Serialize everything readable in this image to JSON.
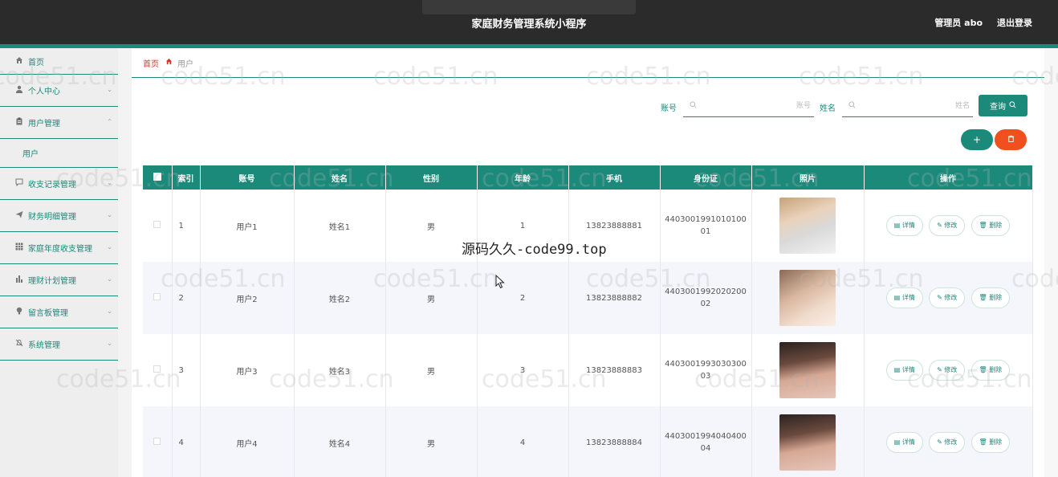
{
  "header": {
    "title": "家庭财务管理系统小程序",
    "user": "管理员 abo",
    "logout": "退出登录"
  },
  "sidebar": {
    "items": [
      {
        "label": "首页",
        "icon": "home-icon"
      },
      {
        "label": "个人中心",
        "icon": "user-icon"
      },
      {
        "label": "用户管理",
        "icon": "clipboard-icon",
        "expanded": true,
        "sub": [
          {
            "label": "用户"
          }
        ]
      },
      {
        "label": "收支记录管理",
        "icon": "chat-icon"
      },
      {
        "label": "财务明细管理",
        "icon": "send-icon"
      },
      {
        "label": "家庭年度收支管理",
        "icon": "grid-icon"
      },
      {
        "label": "理财计划管理",
        "icon": "bar-chart-icon"
      },
      {
        "label": "留言板管理",
        "icon": "bulb-icon"
      },
      {
        "label": "系统管理",
        "icon": "bell-off-icon"
      }
    ]
  },
  "breadcrumb": {
    "home": "首页",
    "current": "用户"
  },
  "search": {
    "account_label": "账号",
    "account_placeholder": "账号",
    "name_label": "姓名",
    "name_placeholder": "姓名",
    "query": "查询"
  },
  "actions": {
    "add": "+"
  },
  "table": {
    "columns": [
      "索引",
      "账号",
      "姓名",
      "性别",
      "年龄",
      "手机",
      "身份证",
      "照片",
      "操作"
    ],
    "rows": [
      {
        "index": "1",
        "account": "用户1",
        "name": "姓名1",
        "gender": "男",
        "age": "1",
        "phone": "13823888881",
        "id_card": "440300199101010001"
      },
      {
        "index": "2",
        "account": "用户2",
        "name": "姓名2",
        "gender": "男",
        "age": "2",
        "phone": "13823888882",
        "id_card": "440300199202020002"
      },
      {
        "index": "3",
        "account": "用户3",
        "name": "姓名3",
        "gender": "男",
        "age": "3",
        "phone": "13823888883",
        "id_card": "440300199303030003"
      },
      {
        "index": "4",
        "account": "用户4",
        "name": "姓名4",
        "gender": "男",
        "age": "4",
        "phone": "13823888884",
        "id_card": "440300199404040004"
      }
    ],
    "row_actions": {
      "detail": "详情",
      "edit": "修改",
      "delete": "删除"
    }
  },
  "watermarks": {
    "site": "code51.cn",
    "overlay": "源码久久-code99.top"
  },
  "colors": {
    "primary": "#1b8a7a",
    "danger": "#f0501e",
    "topbar": "#2b2b2b",
    "breadcrumb_home": "#e0302b"
  }
}
